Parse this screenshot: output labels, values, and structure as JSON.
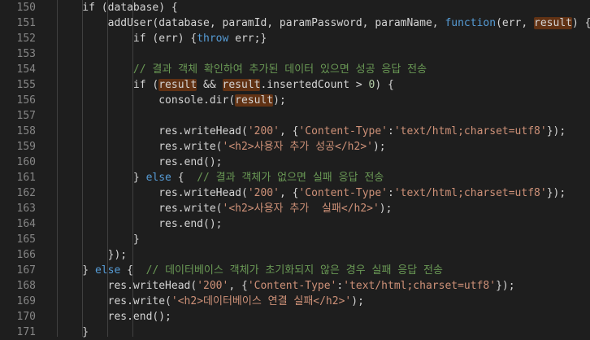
{
  "theme": {
    "background": "#1e1e1e",
    "line_number": "#858585",
    "default": "#d4d4d4",
    "keyword": "#569cd6",
    "function": "#dcdcaa",
    "variable": "#9cdcfe",
    "string": "#ce9178",
    "number": "#b5cea8",
    "comment": "#6a9955",
    "highlight": "#613214"
  },
  "lines": [
    {
      "number": "150",
      "tokens": [
        {
          "t": "    if (database) {",
          "c": "default"
        }
      ]
    },
    {
      "number": "151",
      "tokens": [
        {
          "t": "        addUser(database, paramId, paramPassword, paramName, ",
          "c": "default"
        },
        {
          "t": "function",
          "c": "keyword"
        },
        {
          "t": "(err, ",
          "c": "default"
        },
        {
          "t": "result",
          "c": "default",
          "hl": true
        },
        {
          "t": ") {",
          "c": "default"
        }
      ]
    },
    {
      "number": "152",
      "tokens": [
        {
          "t": "            if (err) {",
          "c": "default"
        },
        {
          "t": "throw",
          "c": "keyword"
        },
        {
          "t": " err;}",
          "c": "default"
        }
      ]
    },
    {
      "number": "153",
      "tokens": []
    },
    {
      "number": "154",
      "tokens": [
        {
          "t": "            // 결과 객체 확인하여 추가된 데이터 있으면 성공 응답 전송",
          "c": "comment"
        }
      ]
    },
    {
      "number": "155",
      "tokens": [
        {
          "t": "            if (",
          "c": "default"
        },
        {
          "t": "result",
          "c": "default",
          "hl": true
        },
        {
          "t": " && ",
          "c": "default"
        },
        {
          "t": "result",
          "c": "default",
          "hl": true
        },
        {
          "t": ".insertedCount > ",
          "c": "default"
        },
        {
          "t": "0",
          "c": "number"
        },
        {
          "t": ") {",
          "c": "default"
        }
      ]
    },
    {
      "number": "156",
      "tokens": [
        {
          "t": "                console.dir(",
          "c": "default"
        },
        {
          "t": "result",
          "c": "default",
          "hl": true
        },
        {
          "t": ");",
          "c": "default"
        }
      ]
    },
    {
      "number": "157",
      "tokens": []
    },
    {
      "number": "158",
      "tokens": [
        {
          "t": "                res.writeHead(",
          "c": "default"
        },
        {
          "t": "'200'",
          "c": "string"
        },
        {
          "t": ", {",
          "c": "default"
        },
        {
          "t": "'Content-Type'",
          "c": "string"
        },
        {
          "t": ":",
          "c": "default"
        },
        {
          "t": "'text/html;charset=utf8'",
          "c": "string"
        },
        {
          "t": "});",
          "c": "default"
        }
      ]
    },
    {
      "number": "159",
      "tokens": [
        {
          "t": "                res.write(",
          "c": "default"
        },
        {
          "t": "'<h2>사용자 추가 성공</h2>'",
          "c": "string"
        },
        {
          "t": ");",
          "c": "default"
        }
      ]
    },
    {
      "number": "160",
      "tokens": [
        {
          "t": "                res.end();",
          "c": "default"
        }
      ]
    },
    {
      "number": "161",
      "tokens": [
        {
          "t": "            } ",
          "c": "default"
        },
        {
          "t": "else",
          "c": "keyword"
        },
        {
          "t": " {  ",
          "c": "default"
        },
        {
          "t": "// 결과 객체가 없으면 실패 응답 전송",
          "c": "comment"
        }
      ]
    },
    {
      "number": "162",
      "tokens": [
        {
          "t": "                res.writeHead(",
          "c": "default"
        },
        {
          "t": "'200'",
          "c": "string"
        },
        {
          "t": ", {",
          "c": "default"
        },
        {
          "t": "'Content-Type'",
          "c": "string"
        },
        {
          "t": ":",
          "c": "default"
        },
        {
          "t": "'text/html;charset=utf8'",
          "c": "string"
        },
        {
          "t": "});",
          "c": "default"
        }
      ]
    },
    {
      "number": "163",
      "tokens": [
        {
          "t": "                res.write(",
          "c": "default"
        },
        {
          "t": "'<h2>사용자 추가  실패</h2>'",
          "c": "string"
        },
        {
          "t": ");",
          "c": "default"
        }
      ]
    },
    {
      "number": "164",
      "tokens": [
        {
          "t": "                res.end();",
          "c": "default"
        }
      ]
    },
    {
      "number": "165",
      "tokens": [
        {
          "t": "            }",
          "c": "default"
        }
      ]
    },
    {
      "number": "166",
      "tokens": [
        {
          "t": "        });",
          "c": "default"
        }
      ]
    },
    {
      "number": "167",
      "tokens": [
        {
          "t": "    } ",
          "c": "default"
        },
        {
          "t": "else",
          "c": "keyword"
        },
        {
          "t": " {  ",
          "c": "default"
        },
        {
          "t": "// 데이터베이스 객체가 초기화되지 않은 경우 실패 응답 전송",
          "c": "comment"
        }
      ]
    },
    {
      "number": "168",
      "tokens": [
        {
          "t": "        res.writeHead(",
          "c": "default"
        },
        {
          "t": "'200'",
          "c": "string"
        },
        {
          "t": ", {",
          "c": "default"
        },
        {
          "t": "'Content-Type'",
          "c": "string"
        },
        {
          "t": ":",
          "c": "default"
        },
        {
          "t": "'text/html;charset=utf8'",
          "c": "string"
        },
        {
          "t": "});",
          "c": "default"
        }
      ]
    },
    {
      "number": "169",
      "tokens": [
        {
          "t": "        res.write(",
          "c": "default"
        },
        {
          "t": "'<h2>데이터베이스 연결 실패</h2>'",
          "c": "string"
        },
        {
          "t": ");",
          "c": "default"
        }
      ]
    },
    {
      "number": "170",
      "tokens": [
        {
          "t": "        res.end();",
          "c": "default"
        }
      ]
    },
    {
      "number": "171",
      "tokens": [
        {
          "t": "    }",
          "c": "default"
        }
      ]
    }
  ]
}
